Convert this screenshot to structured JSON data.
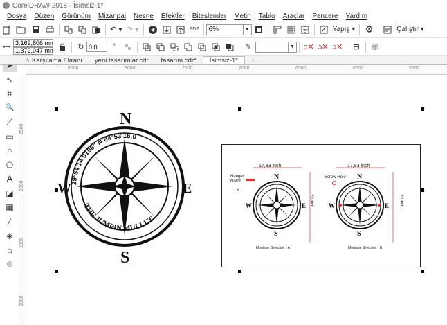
{
  "app": {
    "title": "CorelDRAW 2018 - İsimsiz-1*"
  },
  "menu": [
    "Dosya",
    "Düzen",
    "Görünüm",
    "Mizanpaj",
    "Nesne",
    "Efektler",
    "Biteşlemler",
    "Metin",
    "Tablo",
    "Araçlar",
    "Pencere",
    "Yardım"
  ],
  "toolbar1": {
    "zoom_value": "6%",
    "snap_label": "Yapış",
    "launch_label": "Çalıştır"
  },
  "toolbar2": {
    "x_value": "3.169,806 mm",
    "y_value": "1.372,047 mm",
    "angle_value": "0,0"
  },
  "tabs": [
    "Karşılama Ekranı",
    "yeni tasarımlar.cdr",
    "tasarım.cdr*",
    "İsimsiz-1*"
  ],
  "hruler_ticks": [
    "8500",
    "8000",
    "7500",
    "7000",
    "6500",
    "6000",
    "5500"
  ],
  "vruler_ticks": [
    "2500",
    "2000",
    "1500",
    "1000"
  ],
  "compass_large": {
    "north": "N",
    "south": "S",
    "east": "E",
    "west": "W",
    "ring_text_top": "29°54'14.0106\" N   84°53'16.0",
    "ring_text_bottom": "THE JUMPIN MULLET"
  },
  "sheet": {
    "dim_a": "17,83 inch",
    "dim_b": "17,83 inch",
    "vdim_a": "20 inch",
    "vdim_b": "20 inch",
    "hanger_label": "Hanger Notch",
    "screw_label": "Screw Hole",
    "caption_a": "Montage Selection - A",
    "caption_b": "Montage Selection - B",
    "north": "N",
    "south": "S",
    "east": "E",
    "west": "W"
  }
}
